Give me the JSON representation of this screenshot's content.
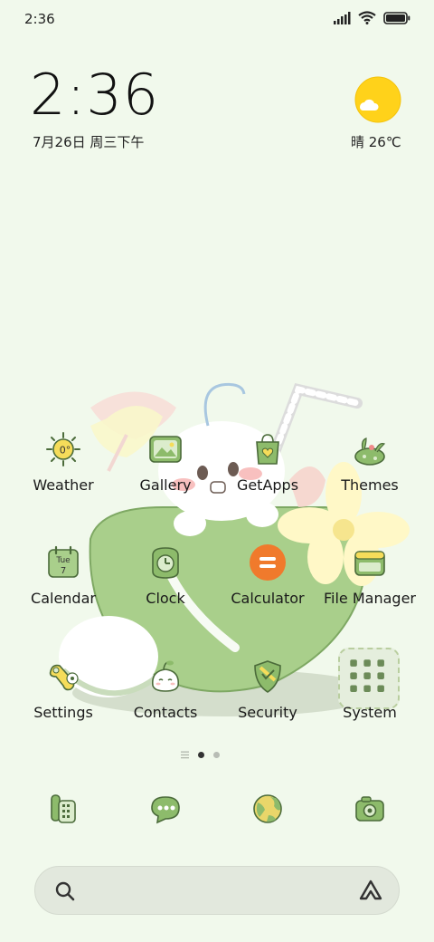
{
  "status_bar": {
    "time": "2:36"
  },
  "clock_widget": {
    "time": "2:36",
    "date": "7月26日 周三下午"
  },
  "weather_widget": {
    "text": "晴 26℃"
  },
  "apps": [
    {
      "name": "Weather",
      "icon": "weather-icon",
      "badge": "0°"
    },
    {
      "name": "Gallery",
      "icon": "gallery-icon"
    },
    {
      "name": "GetApps",
      "icon": "getapps-icon"
    },
    {
      "name": "Themes",
      "icon": "themes-icon"
    },
    {
      "name": "Calendar",
      "icon": "calendar-icon",
      "day_name": "Tue",
      "day_num": "7"
    },
    {
      "name": "Clock",
      "icon": "clock-icon"
    },
    {
      "name": "Calculator",
      "icon": "calculator-icon"
    },
    {
      "name": "File Manager",
      "icon": "file-manager-icon"
    },
    {
      "name": "Settings",
      "icon": "settings-icon"
    },
    {
      "name": "Contacts",
      "icon": "contacts-icon"
    },
    {
      "name": "Security",
      "icon": "security-icon"
    },
    {
      "name": "System",
      "icon": "system-folder-icon"
    }
  ],
  "dock": [
    {
      "icon": "phone-icon"
    },
    {
      "icon": "messages-icon"
    },
    {
      "icon": "browser-icon"
    },
    {
      "icon": "camera-icon"
    }
  ],
  "page_indicator": {
    "pages": 2,
    "current": 1
  },
  "search_bar": {
    "left_icon": "search-icon",
    "right_icon": "assistant-icon"
  },
  "colors": {
    "background": "#f1f9ec",
    "icon_green": "#8dbb6b",
    "icon_outline": "#4b6b3a",
    "calculator": "#f07a2c",
    "sun": "#ffd21a"
  }
}
